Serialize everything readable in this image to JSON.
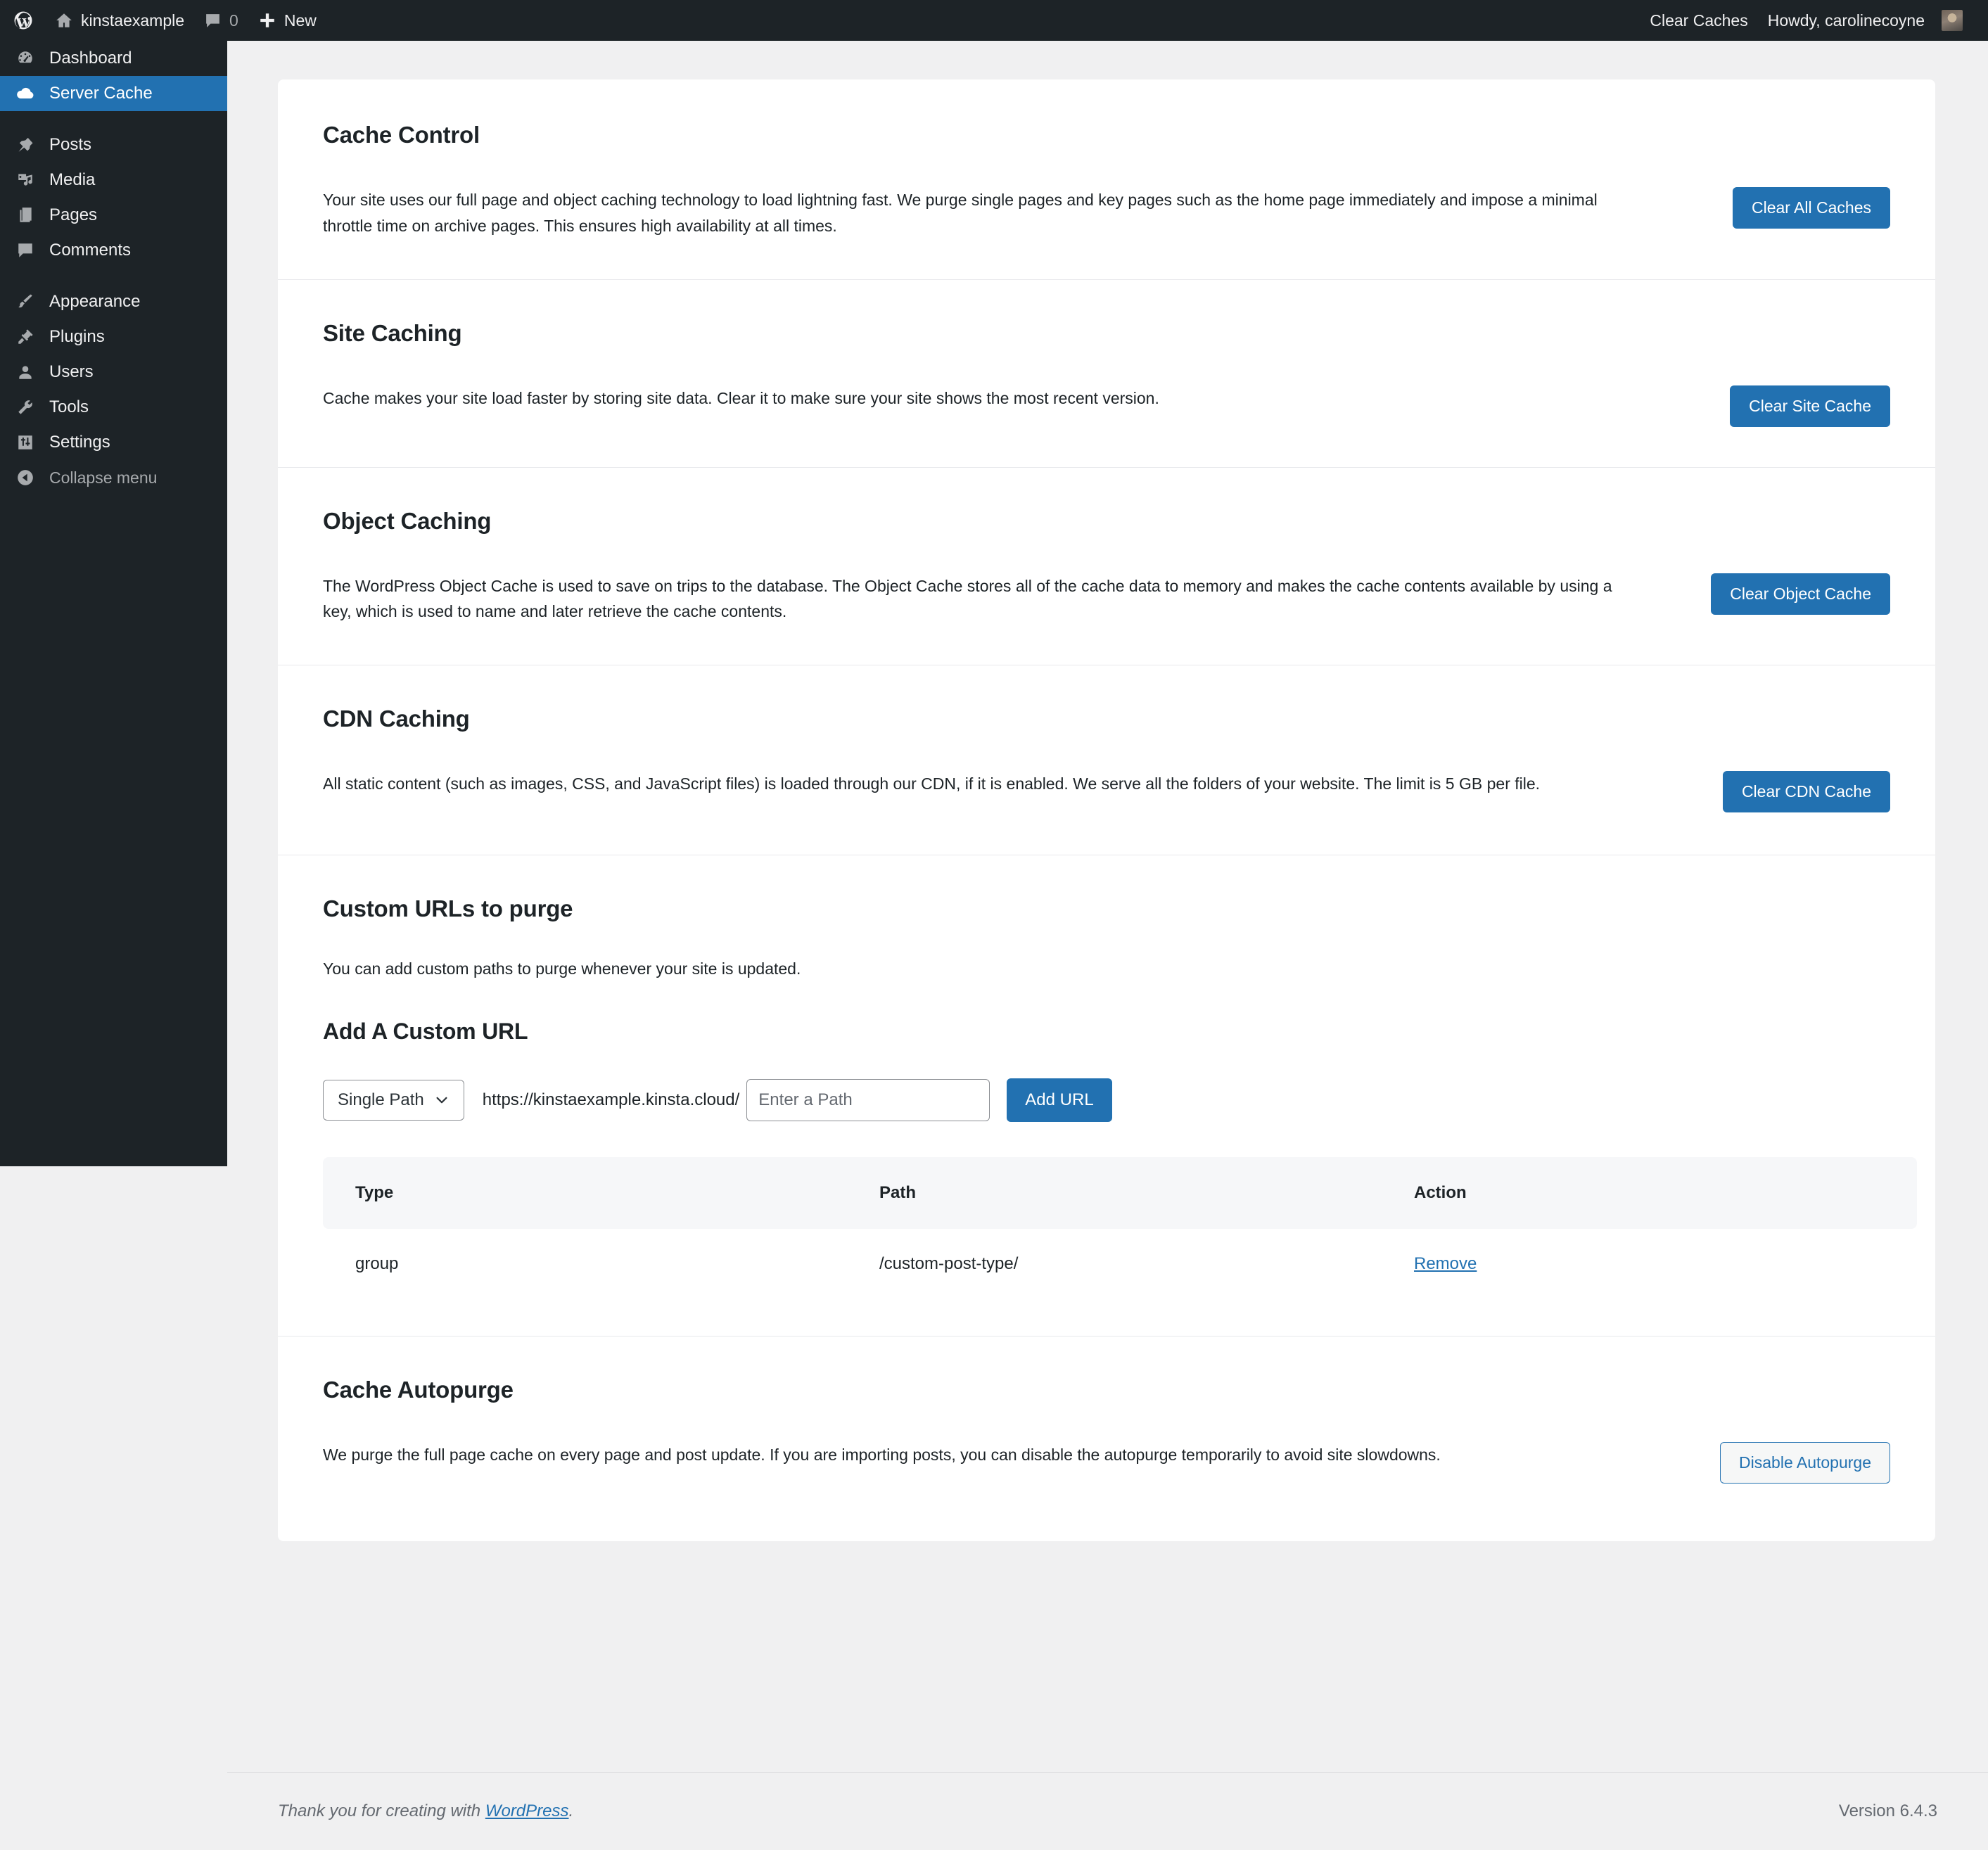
{
  "adminbar": {
    "wp_logo": "wordpress-logo-icon",
    "site_name": "kinstaexample",
    "comments_count": "0",
    "new_label": "New",
    "clear_caches_label": "Clear Caches",
    "howdy": "Howdy, carolinecoyne"
  },
  "sidebar": {
    "items": [
      {
        "label": "Dashboard",
        "icon": "dashboard-icon",
        "current": false
      },
      {
        "label": "Server Cache",
        "icon": "cloud-icon",
        "current": true
      },
      {
        "label": "Posts",
        "icon": "pin-icon",
        "current": false
      },
      {
        "label": "Media",
        "icon": "media-icon",
        "current": false
      },
      {
        "label": "Pages",
        "icon": "pages-icon",
        "current": false
      },
      {
        "label": "Comments",
        "icon": "comment-icon",
        "current": false
      },
      {
        "label": "Appearance",
        "icon": "paintbrush-icon",
        "current": false
      },
      {
        "label": "Plugins",
        "icon": "plug-icon",
        "current": false
      },
      {
        "label": "Users",
        "icon": "user-icon",
        "current": false
      },
      {
        "label": "Tools",
        "icon": "wrench-icon",
        "current": false
      },
      {
        "label": "Settings",
        "icon": "sliders-icon",
        "current": false
      }
    ],
    "collapse_label": "Collapse menu",
    "collapse_icon": "chevron-left-circle-icon"
  },
  "sections": {
    "cache_control": {
      "title": "Cache Control",
      "body": "Your site uses our full page and object caching technology to load lightning fast. We purge single pages and key pages such as the home page immediately and impose a minimal throttle time on archive pages. This ensures high availability at all times.",
      "button": "Clear All Caches"
    },
    "site_caching": {
      "title": "Site Caching",
      "body": "Cache makes your site load faster by storing site data. Clear it to make sure your site shows the most recent version.",
      "button": "Clear Site Cache"
    },
    "object_caching": {
      "title": "Object Caching",
      "body": "The WordPress Object Cache is used to save on trips to the database. The Object Cache stores all of the cache data to memory and makes the cache contents available by using a key, which is used to name and later retrieve the cache contents.",
      "button": "Clear Object Cache"
    },
    "cdn_caching": {
      "title": "CDN Caching",
      "body": "All static content (such as images, CSS, and JavaScript files) is loaded through our CDN, if it is enabled. We serve all the folders of your website. The limit is 5 GB per file.",
      "button": "Clear CDN Cache"
    },
    "custom_urls": {
      "title": "Custom URLs to purge",
      "body": "You can add custom paths to purge whenever your site is updated.",
      "add_title": "Add A Custom URL",
      "select_value": "Single Path",
      "select_icon": "chevron-down-icon",
      "url_prefix": "https://kinstaexample.kinsta.cloud/",
      "path_placeholder": "Enter a Path",
      "path_value": "",
      "add_button": "Add URL",
      "table": {
        "headers": [
          "Type",
          "Path",
          "Action"
        ],
        "rows": [
          {
            "type": "group",
            "path": "/custom-post-type/",
            "action": "Remove"
          }
        ]
      }
    },
    "autopurge": {
      "title": "Cache Autopurge",
      "body": "We purge the full page cache on every page and post update. If you are importing posts, you can disable the autopurge temporarily to avoid site slowdowns.",
      "button": "Disable Autopurge"
    }
  },
  "footer": {
    "thanks_prefix": "Thank you for creating with ",
    "wordpress_link": "WordPress",
    "thanks_suffix": ".",
    "version": "Version 6.4.3"
  },
  "colors": {
    "accent": "#2271b1",
    "admin_dark": "#1d2327",
    "page_bg": "#f0f0f1"
  }
}
